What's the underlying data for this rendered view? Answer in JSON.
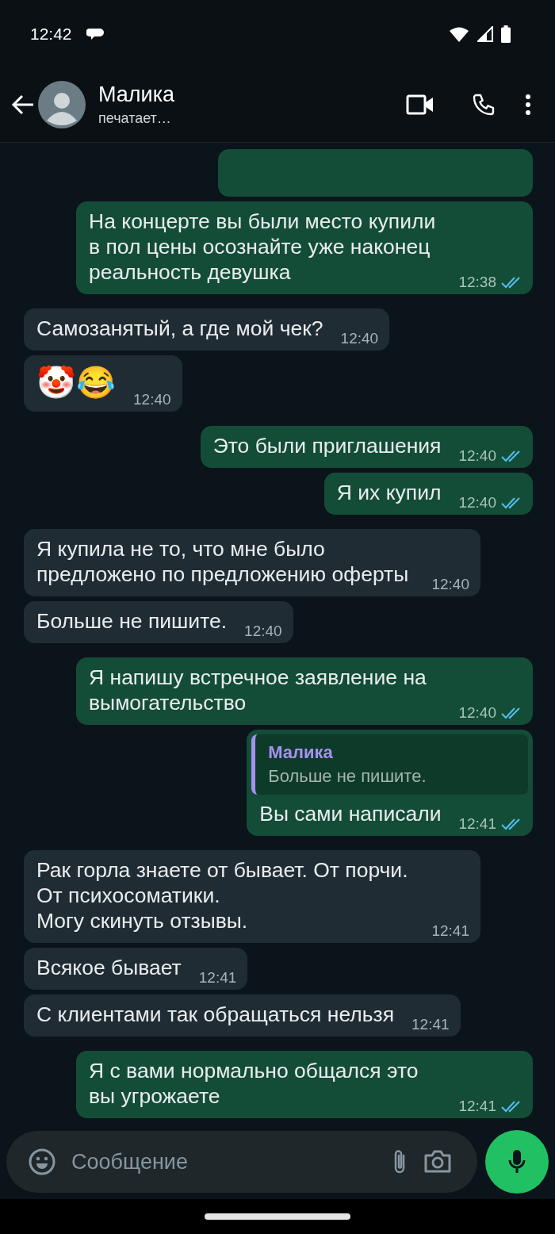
{
  "status_bar": {
    "time": "12:42"
  },
  "header": {
    "name": "Малика",
    "status": "печатает…"
  },
  "messages": [
    {
      "outgoing": true,
      "kind": "partial"
    },
    {
      "outgoing": true,
      "kind": "text",
      "text": "На концерте вы были место купили в пол цены осознайте уже наконец реальность девушка",
      "time": "12:38",
      "read": true
    },
    {
      "outgoing": false,
      "kind": "text",
      "text": "Самозанятый, а где мой чек?",
      "time": "12:40"
    },
    {
      "outgoing": false,
      "kind": "emoji",
      "text": "🤡😂",
      "time": "12:40"
    },
    {
      "outgoing": true,
      "kind": "text",
      "text": "Это были приглашения",
      "time": "12:40",
      "read": true
    },
    {
      "outgoing": true,
      "kind": "text",
      "text": "Я их купил",
      "time": "12:40",
      "read": true
    },
    {
      "outgoing": false,
      "kind": "text",
      "text": "Я купила не то, что мне было предложено по предложению оферты",
      "time": "12:40"
    },
    {
      "outgoing": false,
      "kind": "text",
      "text": "Больше не пишите.",
      "time": "12:40"
    },
    {
      "outgoing": true,
      "kind": "text",
      "text": "Я напишу встречное заявление на вымогательство",
      "time": "12:40",
      "read": true
    },
    {
      "outgoing": true,
      "kind": "reply",
      "quote": {
        "author": "Малика",
        "text": "Больше не пишите."
      },
      "text": "Вы сами написали",
      "time": "12:41",
      "read": true
    },
    {
      "outgoing": false,
      "kind": "text",
      "text": "Рак горла знаете от бывает. От порчи. От психосоматики.\nМогу скинуть отзывы.",
      "time": "12:41"
    },
    {
      "outgoing": false,
      "kind": "text",
      "text": "Всякое бывает",
      "time": "12:41"
    },
    {
      "outgoing": false,
      "kind": "text",
      "text": "С клиентами так обращаться нельзя",
      "time": "12:41"
    },
    {
      "outgoing": true,
      "kind": "text",
      "text": "Я с вами нормально общался это вы угрожаете",
      "time": "12:41",
      "read": true
    }
  ],
  "composer": {
    "placeholder": "Сообщение"
  }
}
